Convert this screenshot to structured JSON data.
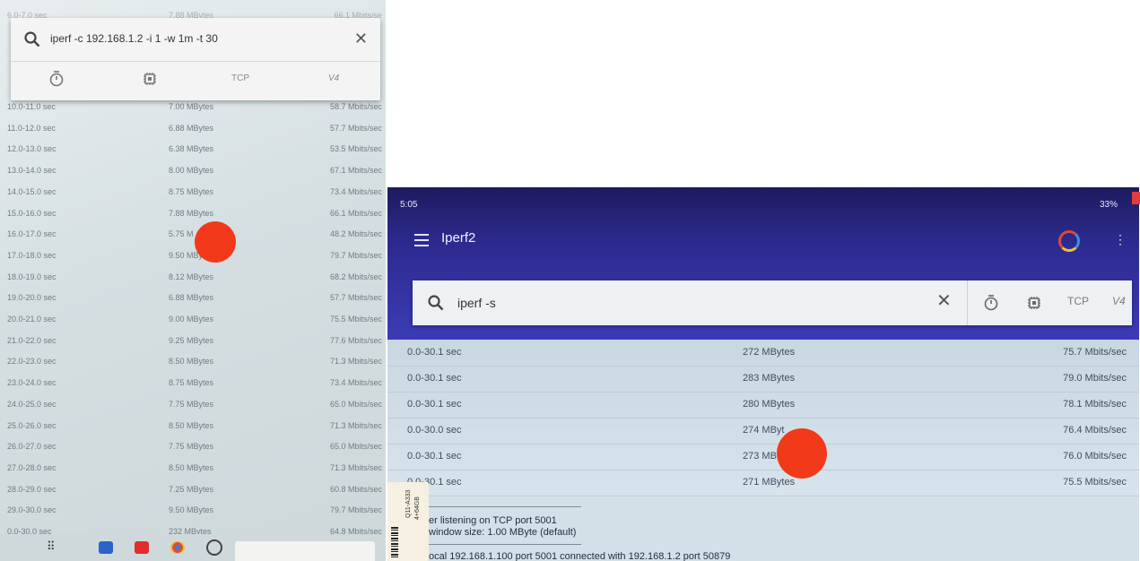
{
  "left": {
    "search": {
      "query": "iperf -c 192.168.1.2 -i 1 -w 1m -t 30"
    },
    "options": {
      "tcp": "TCP",
      "version": "V4"
    },
    "rows": [
      {
        "interval": "6.0-7.0 sec",
        "transfer": "7.88 MBytes",
        "bandwidth": "66.1 Mbits/se"
      },
      {
        "interval": "10.0-11.0 sec",
        "transfer": "7.00 MBytes",
        "bandwidth": "58.7 Mbits/sec"
      },
      {
        "interval": "11.0-12.0 sec",
        "transfer": "6.88 MBytes",
        "bandwidth": "57.7 Mbits/sec"
      },
      {
        "interval": "12.0-13.0 sec",
        "transfer": "6.38 MBytes",
        "bandwidth": "53.5 Mbits/sec"
      },
      {
        "interval": "13.0-14.0 sec",
        "transfer": "8.00 MBytes",
        "bandwidth": "67.1 Mbits/sec"
      },
      {
        "interval": "14.0-15.0 sec",
        "transfer": "8.75 MBytes",
        "bandwidth": "73.4 Mbits/sec"
      },
      {
        "interval": "15.0-16.0 sec",
        "transfer": "7.88 MBytes",
        "bandwidth": "66.1 Mbits/sec"
      },
      {
        "interval": "16.0-17.0 sec",
        "transfer": "5.75 M",
        "bandwidth": "48.2 Mbits/sec"
      },
      {
        "interval": "17.0-18.0 sec",
        "transfer": "9.50 MBy",
        "bandwidth": "79.7 Mbits/sec"
      },
      {
        "interval": "18.0-19.0 sec",
        "transfer": "8.12 MBytes",
        "bandwidth": "68.2 Mbits/sec"
      },
      {
        "interval": "19.0-20.0 sec",
        "transfer": "6.88 MBytes",
        "bandwidth": "57.7 Mbits/sec"
      },
      {
        "interval": "20.0-21.0 sec",
        "transfer": "9.00 MBytes",
        "bandwidth": "75.5 Mbits/sec"
      },
      {
        "interval": "21.0-22.0 sec",
        "transfer": "9.25 MBytes",
        "bandwidth": "77.6 Mbits/sec"
      },
      {
        "interval": "22.0-23.0 sec",
        "transfer": "8.50 MBytes",
        "bandwidth": "71.3 Mbits/sec"
      },
      {
        "interval": "23.0-24.0 sec",
        "transfer": "8.75 MBytes",
        "bandwidth": "73.4 Mbits/sec"
      },
      {
        "interval": "24.0-25.0 sec",
        "transfer": "7.75 MBytes",
        "bandwidth": "65.0 Mbits/sec"
      },
      {
        "interval": "25.0-26.0 sec",
        "transfer": "8.50 MBytes",
        "bandwidth": "71.3 Mbits/sec"
      },
      {
        "interval": "26.0-27.0 sec",
        "transfer": "7.75 MBytes",
        "bandwidth": "65.0 Mbits/sec"
      },
      {
        "interval": "27.0-28.0 sec",
        "transfer": "8.50 MBytes",
        "bandwidth": "71.3 Mbits/sec"
      },
      {
        "interval": "28.0-29.0 sec",
        "transfer": "7.25 MBytes",
        "bandwidth": "60.8 Mbits/sec"
      },
      {
        "interval": "29.0-30.0 sec",
        "transfer": "9.50 MBytes",
        "bandwidth": "79.7 Mbits/sec"
      },
      {
        "interval": "0.0-30.0 sec",
        "transfer": "232 MBytes",
        "bandwidth": "64.8 Mbits/sec"
      }
    ]
  },
  "right": {
    "status": {
      "time": "5:05",
      "battery": "33%"
    },
    "app_title": "Iperf2",
    "search": {
      "query": "iperf -s"
    },
    "options": {
      "tcp": "TCP",
      "version": "V4"
    },
    "rows": [
      {
        "interval": "0.0-30.1 sec",
        "transfer": "272 MBytes",
        "bandwidth": "75.7 Mbits/sec"
      },
      {
        "interval": "0.0-30.1 sec",
        "transfer": "283 MBytes",
        "bandwidth": "79.0 Mbits/sec"
      },
      {
        "interval": "0.0-30.1 sec",
        "transfer": "280 MBytes",
        "bandwidth": "78.1 Mbits/sec"
      },
      {
        "interval": "0.0-30.0 sec",
        "transfer": "274 MByt",
        "bandwidth": "76.4 Mbits/sec"
      },
      {
        "interval": "0.0-30.1 sec",
        "transfer": "273 MB",
        "bandwidth": "76.0 Mbits/sec"
      },
      {
        "interval": "0.0-30.1 sec",
        "transfer": "271 MBytes",
        "bandwidth": "75.5 Mbits/sec"
      }
    ],
    "log": {
      "line1": "er listening on TCP port 5001",
      "line2": " window size: 1.00 MByte (default)",
      "line3": "ocal 192.168.1.100 port 5001 connected with 192.168.1.2 port 50879"
    }
  },
  "sticker": {
    "model": "Q11-A333",
    "storage": "4+64GB"
  },
  "colors": {
    "marker": "#f23a1a",
    "header": "#2c2a8e"
  }
}
